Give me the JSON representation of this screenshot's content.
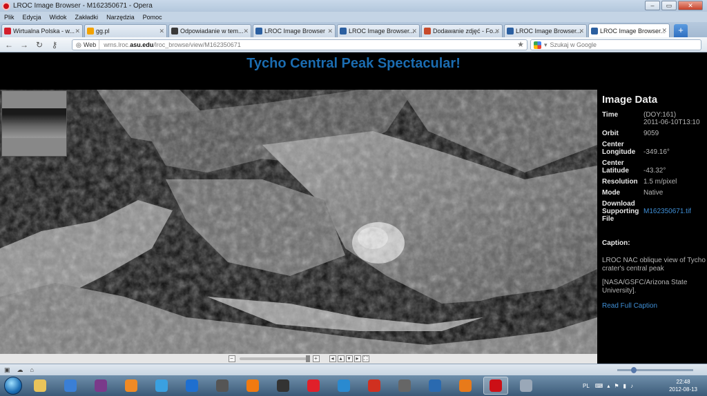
{
  "window": {
    "title": "LROC Image Browser - M162350671 - Opera",
    "controls": [
      "–",
      "▭",
      "✕"
    ]
  },
  "menu": [
    "Plik",
    "Edycja",
    "Widok",
    "Zakładki",
    "Narzędzia",
    "Pomoc"
  ],
  "tabs": [
    {
      "label": "Wirtualna Polska - w...",
      "icon_color": "#d31f2d"
    },
    {
      "label": "gg.pl",
      "icon_color": "#f2a200"
    },
    {
      "label": "Odpowiadanie w tem...",
      "icon_color": "#3a3a3a"
    },
    {
      "label": "LROC Image Browser",
      "icon_color": "#2b5fa0"
    },
    {
      "label": "LROC Image Browser...",
      "icon_color": "#2b5fa0"
    },
    {
      "label": "Dodawanie zdjęć - Fo...",
      "icon_color": "#c74a2b"
    },
    {
      "label": "LROC Image Browser...",
      "icon_color": "#2b5fa0"
    },
    {
      "label": "LROC Image Browser...",
      "icon_color": "#2b5fa0",
      "active": true
    }
  ],
  "newtab_label": "+",
  "address": {
    "web_label": "Web",
    "url_prefix": "wms.lroc.",
    "url_domain": "asu.edu",
    "url_path": "/lroc_browse/view/M162350671",
    "search_placeholder": "Szukaj w Google"
  },
  "page": {
    "title": "Tycho Central Peak Spectacular!"
  },
  "image_data": {
    "heading": "Image Data",
    "rows": [
      {
        "key": "Time",
        "value": "(DOY:161)"
      },
      {
        "key": "",
        "value": "2011-06-10T13:10"
      },
      {
        "key": "Orbit",
        "value": "9059"
      },
      {
        "key": "Center",
        "value": ""
      },
      {
        "key": "Longitude",
        "value": "-349.16°"
      },
      {
        "key": "Center",
        "value": ""
      },
      {
        "key": "Latitude",
        "value": "-43.32°"
      },
      {
        "key": "Resolution",
        "value": "1.5 m/pixel"
      },
      {
        "key": "Mode",
        "value": "Native"
      },
      {
        "key": "Download",
        "value": ""
      },
      {
        "key": "Supporting",
        "value": "M162350671.tif"
      },
      {
        "key": "File",
        "value": ""
      }
    ],
    "caption_title": "Caption:",
    "caption_text": "LROC NAC oblique view of Tycho crater's central peak",
    "caption_credit": "[NASA/GSFC/Arizona State University].",
    "read_more": "Read Full Caption"
  },
  "clock": {
    "time": "22:48",
    "date": "2012-08-13"
  },
  "tray_lang": "PL",
  "colors": {
    "title_blue": "#1b6cb0",
    "link_blue": "#3f8fd6"
  },
  "taskbar_icons": [
    {
      "name": "explorer-icon",
      "color": "#e9c45a"
    },
    {
      "name": "winamp-icon",
      "color": "#3a7fd6"
    },
    {
      "name": "winrar-icon",
      "color": "#7a3a8a"
    },
    {
      "name": "media-player-icon",
      "color": "#f08a24"
    },
    {
      "name": "network-icon",
      "color": "#3aa0e0"
    },
    {
      "name": "bc-icon",
      "color": "#1e6fd0"
    },
    {
      "name": "mouse-icon",
      "color": "#555555"
    },
    {
      "name": "orange-icon",
      "color": "#f07a10"
    },
    {
      "name": "ea-icon",
      "color": "#333333"
    },
    {
      "name": "red-star-icon",
      "color": "#e0202a"
    },
    {
      "name": "blue-disk-icon",
      "color": "#2a8ad0"
    },
    {
      "name": "red-game-icon",
      "color": "#d03020"
    },
    {
      "name": "wrench-icon",
      "color": "#666666"
    },
    {
      "name": "monitor-icon",
      "color": "#2a6ab0"
    },
    {
      "name": "firefox-icon",
      "color": "#e87a1a"
    },
    {
      "name": "opera-icon",
      "color": "#cc0f16",
      "active": true
    },
    {
      "name": "misc-icon",
      "color": "#9aa8b8"
    }
  ]
}
